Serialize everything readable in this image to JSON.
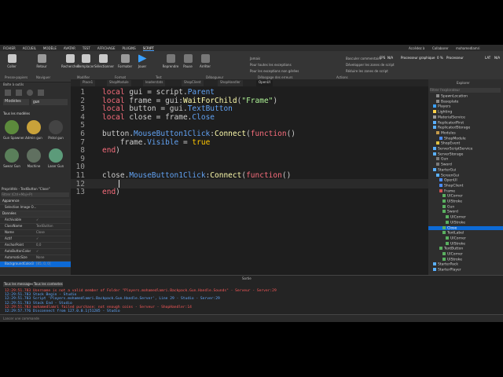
{
  "menubar": {
    "items": [
      "FICHIER",
      "ACCUEIL",
      "MODÈLE",
      "AVATAR",
      "TEST",
      "AFFICHAGE",
      "PLUGINS",
      "SCRIPT"
    ],
    "active": "SCRIPT",
    "right": [
      "Accédez à",
      "Collaborer",
      "mohamedlamri"
    ]
  },
  "ribbon": {
    "tools": [
      {
        "label": "Coller",
        "icon": "paste-icon"
      },
      {
        "label": "Retour",
        "icon": "back-icon"
      },
      {
        "label": "Rechercher",
        "icon": "find-icon"
      },
      {
        "label": "Remplacer",
        "icon": "replace-icon"
      },
      {
        "label": "Sélectionner",
        "icon": "select-icon"
      },
      {
        "label": "Formater",
        "icon": "format-icon"
      },
      {
        "label": "Jouer",
        "icon": "play-icon"
      },
      {
        "label": "Reprendre",
        "icon": "resume-icon"
      },
      {
        "label": "Pause",
        "icon": "pause-icon"
      },
      {
        "label": "Arrêter",
        "icon": "stop-icon"
      }
    ],
    "groups": [
      "Presse-papiers",
      "Naviguer",
      "Modifier",
      "Format",
      "Test",
      "Débogueur",
      "Débogage des erreurs",
      "Actions"
    ],
    "options": [
      "Jamais",
      "Pour toutes les exceptions",
      "Pour les exceptions non gérées"
    ],
    "debug_actions": [
      "Basculer commentaire",
      "Développer les zones de script",
      "Réduire les zones de script"
    ],
    "stats": {
      "fps_label": "FPS",
      "fps": "N/A",
      "cpu_label": "Processeur",
      "cpu": "0 %",
      "lat_label": "LAT",
      "lat": "N/A",
      "gfx": "Processeur graphique"
    }
  },
  "toolbox": {
    "title": "Boîte à outils",
    "search_value": "gun",
    "category": "Modèles",
    "subtitle": "Tous les modèles",
    "items": [
      {
        "label": "Gun Spawner...",
        "color": "#5c8a3c"
      },
      {
        "label": "Admin gun",
        "color": "#c9a23a"
      },
      {
        "label": "Pistol gun",
        "color": "#444444"
      },
      {
        "label": "Swear Gun",
        "color": "#5a7f5a"
      },
      {
        "label": "Machine",
        "color": "#607060"
      },
      {
        "label": "Laser Gun",
        "color": "#5c9b7a"
      }
    ],
    "properties_title": "Propriétés - TextButton \"Close\"",
    "filter_placeholder": "Filtrer (Ctrl+Maj+P)",
    "sections": [
      "Apparence",
      "Données"
    ],
    "rows": [
      {
        "name": "Selection Image O..."
      },
      {
        "name": "Archivable",
        "value": "✓"
      },
      {
        "name": "ClassName",
        "value": "TextButton"
      },
      {
        "name": "Name",
        "value": "Close"
      },
      {
        "name": "Actif",
        "value": "✓"
      },
      {
        "name": "AnchorPoint",
        "value": "0,0"
      },
      {
        "name": "AutoButtonColor",
        "value": "✓"
      },
      {
        "name": "AutomaticSize",
        "value": "None"
      },
      {
        "name": "BackgroundColor3",
        "value": "[85, 0, 0]"
      }
    ]
  },
  "editor": {
    "tabs": [
      "Place1",
      "ShopModule",
      "leaderstats",
      "ShopClient",
      "ShopHandler",
      "OpenUI"
    ],
    "active_tab": "OpenUI",
    "lines": [
      {
        "n": "1",
        "parts": [
          [
            "kw",
            "local "
          ],
          [
            "id",
            "gui = script."
          ],
          [
            "pr",
            "Parent"
          ]
        ]
      },
      {
        "n": "2",
        "parts": [
          [
            "kw",
            "local "
          ],
          [
            "id",
            "frame = gui:"
          ],
          [
            "fn",
            "WaitForChild"
          ],
          [
            "id",
            "("
          ],
          [
            "str",
            "\"Frame\""
          ],
          [
            "id",
            ")"
          ]
        ]
      },
      {
        "n": "3",
        "parts": [
          [
            "kw",
            "local "
          ],
          [
            "id",
            "button = gui."
          ],
          [
            "pr",
            "TextButton"
          ]
        ]
      },
      {
        "n": "4",
        "parts": [
          [
            "kw",
            "local "
          ],
          [
            "id",
            "close = frame."
          ],
          [
            "pr",
            "Close"
          ]
        ]
      },
      {
        "n": "5",
        "parts": []
      },
      {
        "n": "6",
        "parts": [
          [
            "id",
            "button."
          ],
          [
            "pr",
            "MouseButton1Click"
          ],
          [
            "id",
            ":"
          ],
          [
            "fn",
            "Connect"
          ],
          [
            "id",
            "("
          ],
          [
            "kw",
            "function"
          ],
          [
            "id",
            "()"
          ]
        ]
      },
      {
        "n": "7",
        "parts": [
          [
            "id",
            "    frame."
          ],
          [
            "pr",
            "Visible"
          ],
          [
            "id",
            " = "
          ],
          [
            "bool",
            "true"
          ]
        ]
      },
      {
        "n": "8",
        "parts": [
          [
            "kw",
            "end"
          ],
          [
            "id",
            ")"
          ]
        ]
      },
      {
        "n": "9",
        "parts": []
      },
      {
        "n": "10",
        "parts": []
      },
      {
        "n": "11",
        "parts": [
          [
            "id",
            "close."
          ],
          [
            "pr",
            "MouseButton1Click"
          ],
          [
            "id",
            ":"
          ],
          [
            "fn",
            "Connect"
          ],
          [
            "id",
            "("
          ],
          [
            "kw",
            "function"
          ],
          [
            "id",
            "()"
          ]
        ]
      },
      {
        "n": "12",
        "parts": []
      },
      {
        "n": "13",
        "parts": [
          [
            "kw",
            "end"
          ],
          [
            "id",
            ")"
          ]
        ]
      }
    ]
  },
  "explorer": {
    "title": "Explorer",
    "filter_placeholder": "Filtrer l'explorateur",
    "items": [
      {
        "label": "SpawnLocation",
        "indent": 2,
        "color": "#8c8c8c"
      },
      {
        "label": "Baseplate",
        "indent": 2,
        "color": "#8c8c8c"
      },
      {
        "label": "Players",
        "indent": 1,
        "color": "#3aa0ff"
      },
      {
        "label": "Lighting",
        "indent": 1,
        "color": "#ffd34a"
      },
      {
        "label": "MaterialService",
        "indent": 1,
        "color": "#9b9b9b"
      },
      {
        "label": "ReplicatedFirst",
        "indent": 1,
        "color": "#5ab0ff"
      },
      {
        "label": "ReplicatedStorage",
        "indent": 1,
        "color": "#5ab0ff"
      },
      {
        "label": "Modules",
        "indent": 2,
        "color": "#c59b4a"
      },
      {
        "label": "ShopModule",
        "indent": 3,
        "color": "#4a8cff"
      },
      {
        "label": "ShopEvent",
        "indent": 2,
        "color": "#e0c040"
      },
      {
        "label": "ServerScriptService",
        "indent": 1,
        "color": "#5ab0ff"
      },
      {
        "label": "ServerStorage",
        "indent": 1,
        "color": "#5ab0ff"
      },
      {
        "label": "Gun",
        "indent": 2,
        "color": "#7a7a7a"
      },
      {
        "label": "Sword",
        "indent": 2,
        "color": "#7a7a7a"
      },
      {
        "label": "StarterGui",
        "indent": 1,
        "color": "#5ab0ff"
      },
      {
        "label": "ScreenGui",
        "indent": 2,
        "color": "#5ab0ff"
      },
      {
        "label": "OpenUI",
        "indent": 3,
        "color": "#4a8cff"
      },
      {
        "label": "ShopClient",
        "indent": 3,
        "color": "#4a8cff"
      },
      {
        "label": "Frame",
        "indent": 3,
        "color": "#d05050"
      },
      {
        "label": "UICorner",
        "indent": 4,
        "color": "#5ab060"
      },
      {
        "label": "UIStroke",
        "indent": 4,
        "color": "#5ab060"
      },
      {
        "label": "Gun",
        "indent": 4,
        "color": "#5ab060"
      },
      {
        "label": "Sword",
        "indent": 4,
        "color": "#5ab060"
      },
      {
        "label": "UICorner",
        "indent": 5,
        "color": "#5ab060"
      },
      {
        "label": "UIStroke",
        "indent": 5,
        "color": "#5ab060"
      },
      {
        "label": "Close",
        "indent": 4,
        "color": "#5ab060",
        "selected": true
      },
      {
        "label": "TextLabel",
        "indent": 4,
        "color": "#5ab060"
      },
      {
        "label": "UICorner",
        "indent": 5,
        "color": "#5ab060"
      },
      {
        "label": "UIStroke",
        "indent": 5,
        "color": "#5ab060"
      },
      {
        "label": "TextButton",
        "indent": 3,
        "color": "#5ab060"
      },
      {
        "label": "UICorner",
        "indent": 4,
        "color": "#5ab060"
      },
      {
        "label": "UIStroke",
        "indent": 4,
        "color": "#5ab060"
      },
      {
        "label": "StarterPack",
        "indent": 1,
        "color": "#5ab0ff"
      },
      {
        "label": "StarterPlayer",
        "indent": 1,
        "color": "#5ab0ff"
      }
    ]
  },
  "output": {
    "title": "Sortie",
    "filter_messages": "Tous les messages",
    "filter_contexts": "Tous les contextes",
    "lines": [
      {
        "text": "12:29:51.783  Username is not a valid member of Folder \"Players.mohamedlamri.Backpack.Gun.Handle.Sounds\"  -  Serveur - Server:29",
        "color": "#ff5a5a"
      },
      {
        "text": "12:29:51.783  Stack Begin  -  Studio",
        "color": "#62a8ff"
      },
      {
        "text": "12:29:51.783  Script 'Players.mohamedlamri.Backpack.Gun.Handle.Server', Line 29  -  Studio - Server:29",
        "color": "#62a8ff"
      },
      {
        "text": "12:29:51.783  Stack End  -  Studio",
        "color": "#62a8ff"
      },
      {
        "text": "12:29:51.783  mohamedlamri failed purchase: not enough coins  -  Serveur - ShopHandler:14",
        "color": "#ff5a5a"
      },
      {
        "text": "12:29:57.776  Disconnect from 127.0.0.1|51285  -  Studio",
        "color": "#62a8ff"
      }
    ],
    "command_placeholder": "Lancer une commande"
  }
}
